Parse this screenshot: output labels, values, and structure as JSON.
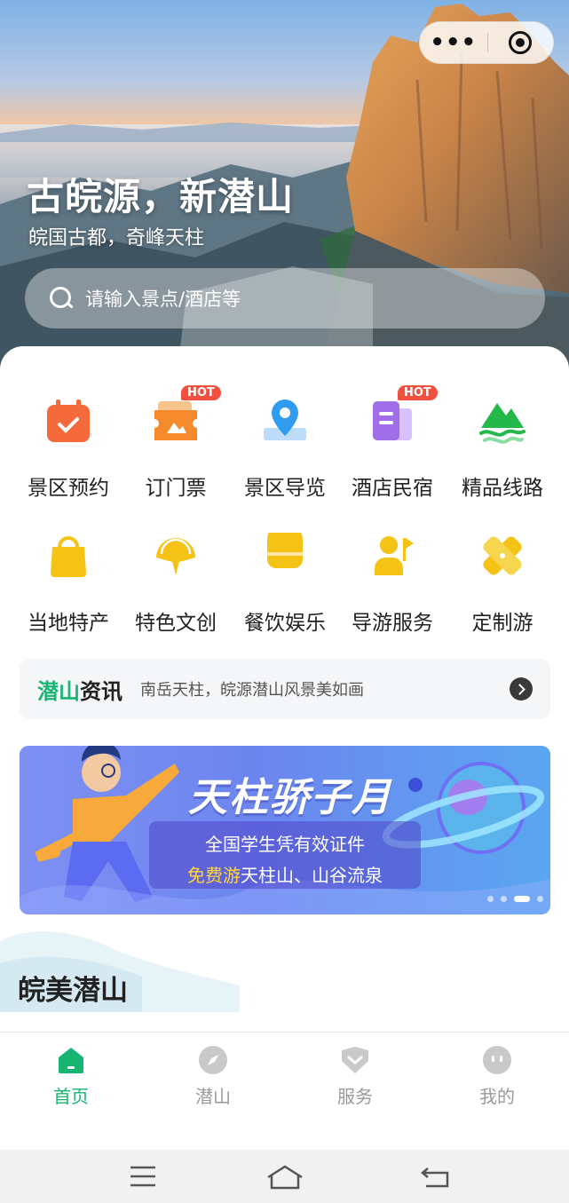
{
  "hero": {
    "title": "古皖源，新潜山",
    "subtitle": "皖国古都，奇峰天柱",
    "capsule": {
      "more_icon": "more-dots-icon",
      "more_glyph": "•••",
      "close_icon": "target-icon"
    }
  },
  "search": {
    "placeholder": "请输入景点/酒店等",
    "icon": "search-icon"
  },
  "grid": {
    "items": [
      {
        "label": "景区预约",
        "icon": "calendar-icon",
        "color": "#f46a3b"
      },
      {
        "label": "订门票",
        "icon": "ticket-icon",
        "color": "#f58a2c",
        "badge": "HOT"
      },
      {
        "label": "景区导览",
        "icon": "map-pin-icon",
        "color": "#2f9cf0"
      },
      {
        "label": "酒店民宿",
        "icon": "hotel-icon",
        "color": "#a06ee8",
        "badge": "HOT"
      },
      {
        "label": "精品线路",
        "icon": "mountain-icon",
        "color": "#24b84a"
      },
      {
        "label": "当地特产",
        "icon": "bag-icon",
        "color": "#f5c216"
      },
      {
        "label": "特色文创",
        "icon": "fan-icon",
        "color": "#f5c216"
      },
      {
        "label": "餐饮娱乐",
        "icon": "bowl-icon",
        "color": "#f5c216"
      },
      {
        "label": "导游服务",
        "icon": "guide-flag-icon",
        "color": "#f5c216"
      },
      {
        "label": "定制游",
        "icon": "custom-tour-icon",
        "color": "#f5c216"
      }
    ]
  },
  "news": {
    "title_green": "潜山",
    "title_dark": "资讯",
    "text": "南岳天柱，皖源潜山风景美如画",
    "arrow_icon": "chevron-right-icon"
  },
  "banner": {
    "title": "天柱骄子月",
    "line1": "全国学生凭有效证件",
    "line2_highlight": "免费游",
    "line2_rest": "天柱山、山谷流泉",
    "slides_total": 4,
    "active_slide": 3
  },
  "section": {
    "title": "皖美潜山"
  },
  "tabbar": {
    "tabs": [
      {
        "label": "首页",
        "icon": "home-icon",
        "active": true
      },
      {
        "label": "潜山",
        "icon": "compass-icon",
        "active": false
      },
      {
        "label": "服务",
        "icon": "service-icon",
        "active": false
      },
      {
        "label": "我的",
        "icon": "profile-icon",
        "active": false
      }
    ]
  },
  "colors": {
    "accent": "#17b472",
    "hot": "#f2503f",
    "inactive": "#9a9a9a"
  },
  "system_nav": {
    "icons": [
      "menu-icon",
      "home-outline-icon",
      "back-icon"
    ]
  }
}
